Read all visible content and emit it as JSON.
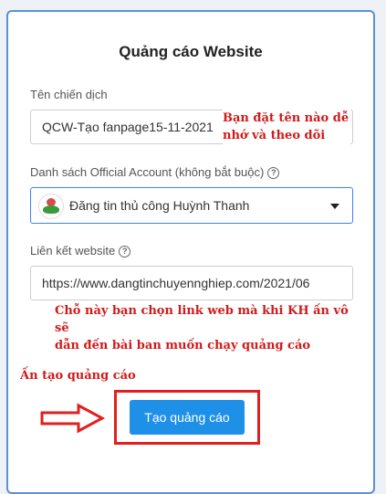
{
  "dialog": {
    "title": "Quảng cáo Website",
    "campaign_label": "Tên chiến dịch",
    "campaign_value": "QCW-Tạo fanpage15-11-2021",
    "oa_label": "Danh sách Official Account (không bắt buộc)",
    "oa_value": "Đăng tin thủ công Huỳnh Thanh",
    "link_label": "Liên kết website",
    "link_value": "https://www.dangtinchuyennghiep.com/2021/06",
    "help_glyph": "?",
    "create_button": "Tạo quảng cáo"
  },
  "annotations": {
    "name_note_line1": "Bạn đặt tên nào dễ",
    "name_note_line2": "nhớ và theo dõi",
    "link_note_line1": "Chỗ này bạn chọn link web mà khi KH ấn vô sẽ",
    "link_note_line2": "dẫn đến bài ban muốn chạy quảng cáo",
    "create_note": "Ấn tạo quảng cáo"
  },
  "colors": {
    "accent": "#1e90e8",
    "annotation": "#d11a1a",
    "card_border": "#5b8fd6"
  },
  "icons": {
    "help": "question-circle-icon",
    "caret": "chevron-down-icon",
    "arrow": "right-arrow-icon",
    "avatar": "page-avatar"
  }
}
